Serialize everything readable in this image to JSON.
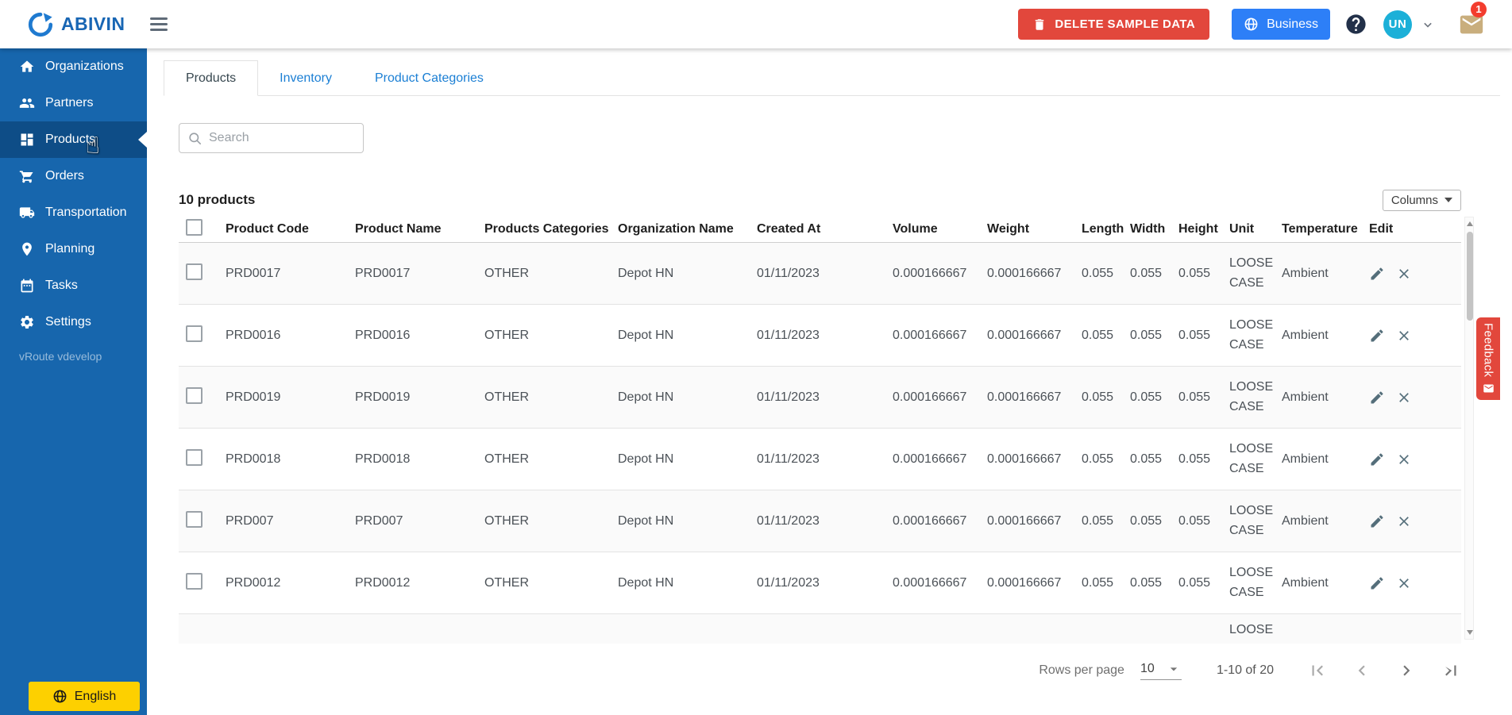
{
  "topbar": {
    "brand": "ABIVIN",
    "delete_button": "DELETE SAMPLE DATA",
    "business_button": "Business",
    "avatar_initials": "UN",
    "notification_badge": "1"
  },
  "sidebar": {
    "items": [
      {
        "label": "Organizations",
        "icon": "home",
        "active": false
      },
      {
        "label": "Partners",
        "icon": "people",
        "active": false
      },
      {
        "label": "Products",
        "icon": "products-grid",
        "active": true
      },
      {
        "label": "Orders",
        "icon": "cart",
        "active": false
      },
      {
        "label": "Transportation",
        "icon": "truck",
        "active": false
      },
      {
        "label": "Planning",
        "icon": "map-pin",
        "active": false
      },
      {
        "label": "Tasks",
        "icon": "calendar",
        "active": false
      },
      {
        "label": "Settings",
        "icon": "gear",
        "active": false
      }
    ],
    "version_label": "vRoute vdevelop",
    "language_button": "English"
  },
  "tabs": {
    "products": "Products",
    "inventory": "Inventory",
    "product_categories": "Product Categories"
  },
  "search": {
    "placeholder": "Search"
  },
  "products_list": {
    "summary": "10 products",
    "columns_button": "Columns",
    "headers": {
      "code": "Product Code",
      "name": "Product Name",
      "categories": "Products Categories",
      "organization": "Organization Name",
      "created": "Created At",
      "volume": "Volume",
      "weight": "Weight",
      "length": "Length",
      "width": "Width",
      "height": "Height",
      "unit": "Unit",
      "temperature": "Temperature",
      "edit": "Edit"
    },
    "rows": [
      {
        "code": "PRD0017",
        "name": "PRD0017",
        "category": "OTHER",
        "org": "Depot HN",
        "created": "01/11/2023",
        "volume": "0.000166667",
        "weight": "0.000166667",
        "length": "0.055",
        "width": "0.055",
        "height": "0.055",
        "unit": "LOOSE CASE",
        "temp": "Ambient"
      },
      {
        "code": "PRD0016",
        "name": "PRD0016",
        "category": "OTHER",
        "org": "Depot HN",
        "created": "01/11/2023",
        "volume": "0.000166667",
        "weight": "0.000166667",
        "length": "0.055",
        "width": "0.055",
        "height": "0.055",
        "unit": "LOOSE CASE",
        "temp": "Ambient"
      },
      {
        "code": "PRD0019",
        "name": "PRD0019",
        "category": "OTHER",
        "org": "Depot HN",
        "created": "01/11/2023",
        "volume": "0.000166667",
        "weight": "0.000166667",
        "length": "0.055",
        "width": "0.055",
        "height": "0.055",
        "unit": "LOOSE CASE",
        "temp": "Ambient"
      },
      {
        "code": "PRD0018",
        "name": "PRD0018",
        "category": "OTHER",
        "org": "Depot HN",
        "created": "01/11/2023",
        "volume": "0.000166667",
        "weight": "0.000166667",
        "length": "0.055",
        "width": "0.055",
        "height": "0.055",
        "unit": "LOOSE CASE",
        "temp": "Ambient"
      },
      {
        "code": "PRD007",
        "name": "PRD007",
        "category": "OTHER",
        "org": "Depot HN",
        "created": "01/11/2023",
        "volume": "0.000166667",
        "weight": "0.000166667",
        "length": "0.055",
        "width": "0.055",
        "height": "0.055",
        "unit": "LOOSE CASE",
        "temp": "Ambient"
      },
      {
        "code": "PRD0012",
        "name": "PRD0012",
        "category": "OTHER",
        "org": "Depot HN",
        "created": "01/11/2023",
        "volume": "0.000166667",
        "weight": "0.000166667",
        "length": "0.055",
        "width": "0.055",
        "height": "0.055",
        "unit": "LOOSE CASE",
        "temp": "Ambient"
      }
    ],
    "partial_row": {
      "unit": "LOOSE"
    }
  },
  "pagination": {
    "rows_per_page_label": "Rows per page",
    "rows_per_page_value": "10",
    "range_label": "1-10 of 20"
  },
  "feedback": {
    "label": "Feedback"
  },
  "colors": {
    "sidebar": "#1766ad",
    "sidebar-active": "#0e4d87",
    "danger": "#e2473c",
    "primary-blue": "#2d7ff7",
    "avatar-teal": "#1cb0d8",
    "feedback-red": "#e2473c",
    "language-yellow": "#fdd000",
    "link-blue": "#1b7fd4"
  }
}
